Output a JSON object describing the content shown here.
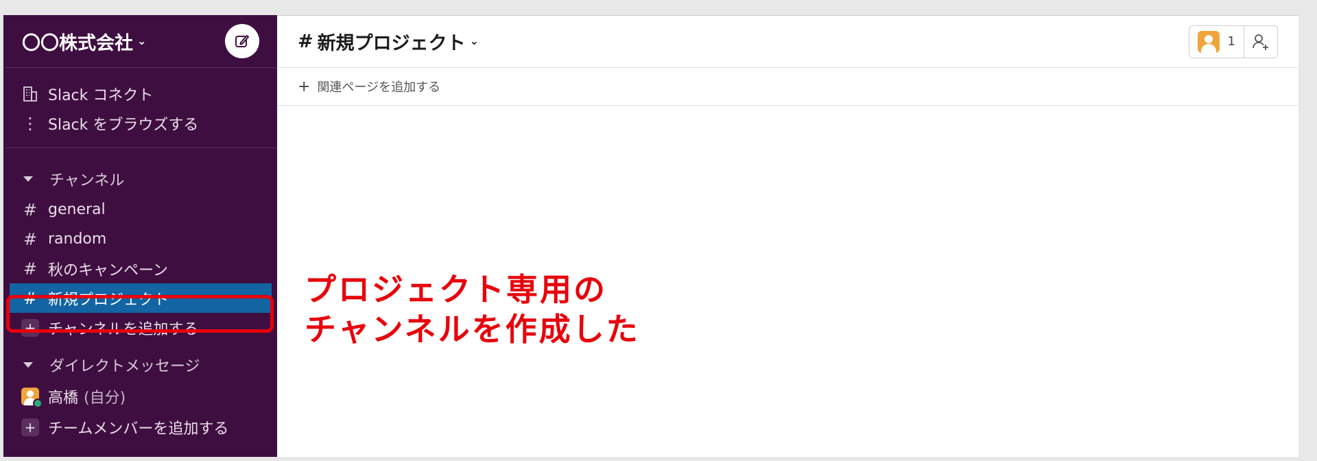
{
  "workspace": {
    "name": "〇〇株式会社"
  },
  "sidebar": {
    "top_items": [
      {
        "label": "Slack コネクト",
        "icon": "building-icon"
      },
      {
        "label": "Slack をブラウズする",
        "icon": "more-vertical-icon"
      }
    ],
    "channels_header": "チャンネル",
    "channels": [
      {
        "label": "general"
      },
      {
        "label": "random"
      },
      {
        "label": "秋のキャンペーン"
      },
      {
        "label": "新規プロジェクト",
        "active": true
      }
    ],
    "add_channel": "チャンネルを追加する",
    "dm_header": "ダイレクトメッセージ",
    "dm_user": {
      "name": "高橋",
      "suffix": "(自分)"
    },
    "add_member": "チームメンバーを追加する"
  },
  "channel": {
    "title": "新規プロジェクト",
    "hash": "#",
    "member_count": "1",
    "bookmark_label": "関連ページを追加する",
    "bookmark_plus": "+"
  },
  "annotation": {
    "line1": "プロジェクト専用の",
    "line2": "チャンネルを作成した",
    "color": "#e8000b"
  },
  "colors": {
    "sidebar": "#3f0e40",
    "active": "#1264a3"
  }
}
